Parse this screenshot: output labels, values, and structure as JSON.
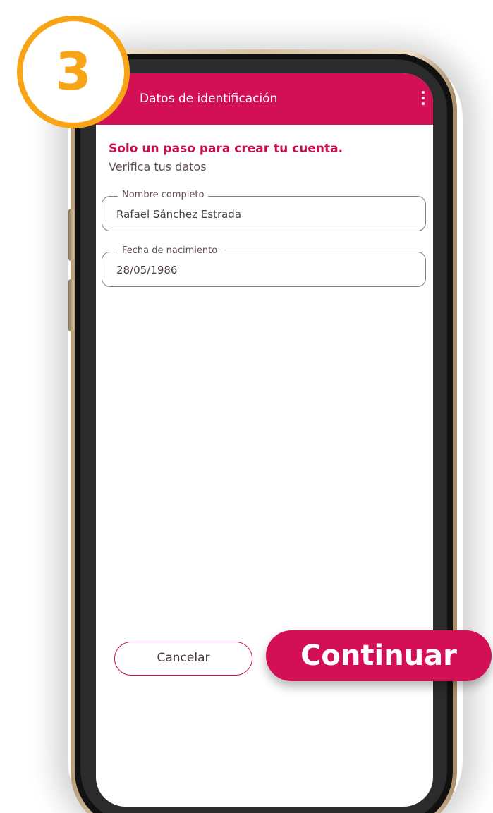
{
  "step": {
    "number": "3"
  },
  "app_bar": {
    "title": "Datos de identificación",
    "menu_icon": "more-vert-icon"
  },
  "content": {
    "headline": "Solo un paso para crear tu cuenta.",
    "subheadline": "Verifica tus datos"
  },
  "fields": [
    {
      "label": "Nombre completo",
      "value": "Rafael Sánchez Estrada"
    },
    {
      "label": "Fecha de nacimiento",
      "value": "28/05/1986"
    }
  ],
  "actions": {
    "cancel_label": "Cancelar",
    "continue_label": "Continuar"
  },
  "colors": {
    "brand_primary": "#d30f55",
    "headline": "#c8104f",
    "step_badge": "#f7a416",
    "phone_frame": "#d8c2a2"
  }
}
